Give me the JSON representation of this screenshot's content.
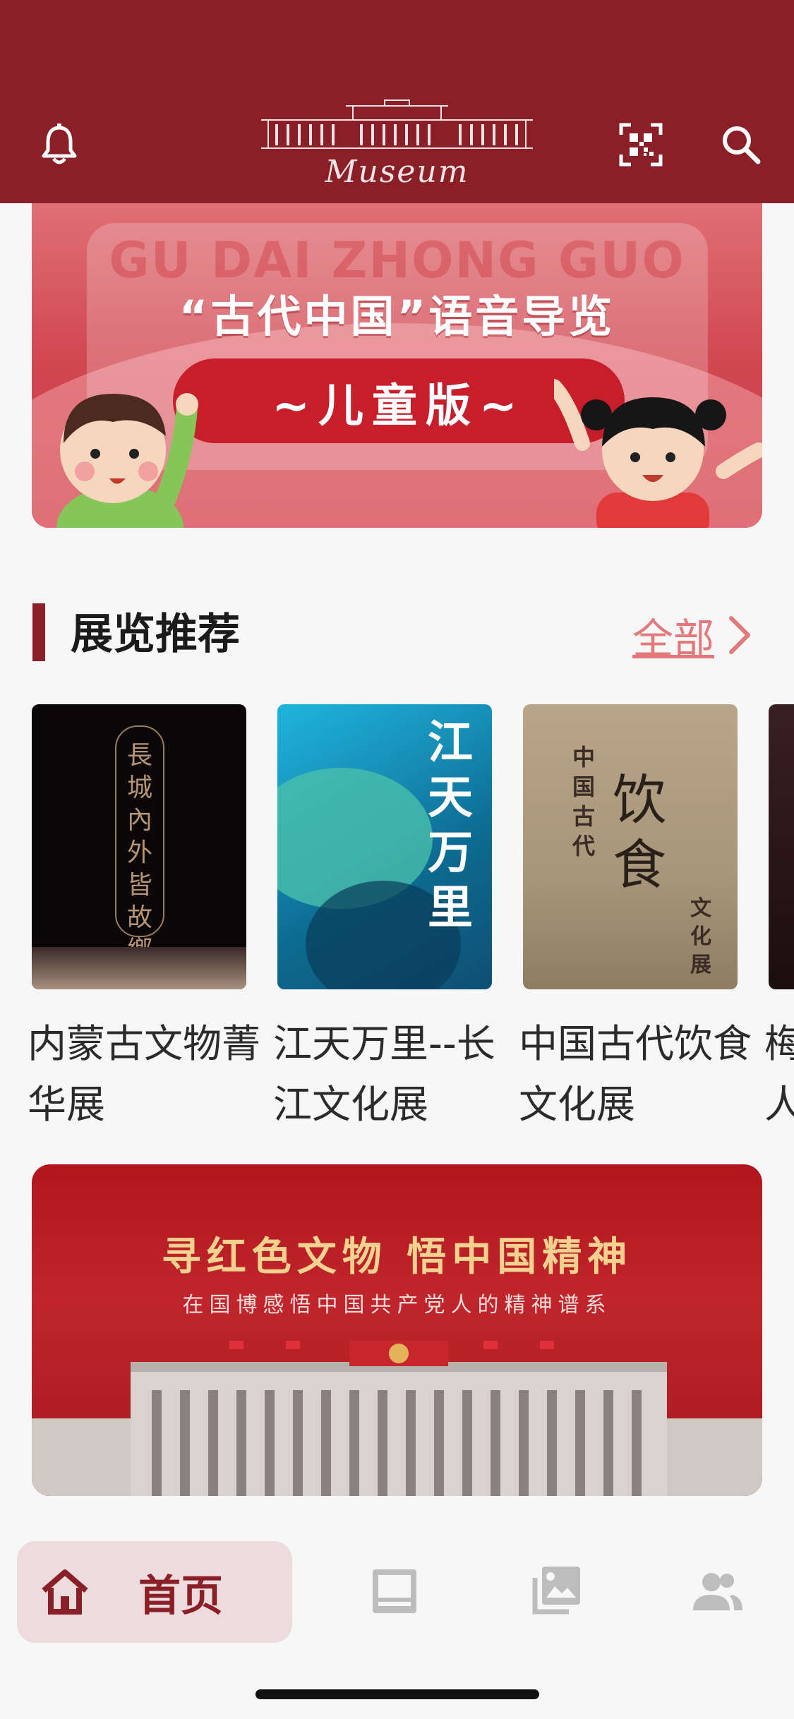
{
  "header": {
    "logo_text": "Museum",
    "icons": [
      "bell-icon",
      "qr-scan-icon",
      "search-icon"
    ],
    "bg_color": "#8a1f27"
  },
  "banner_top": {
    "ghost_text": "GU DAI ZHONG GUO",
    "title": "“古代中国”语音导览",
    "subtitle": "~儿童版~"
  },
  "section": {
    "title": "展览推荐",
    "see_all": "全部"
  },
  "exhibitions": [
    {
      "caption": "内蒙古文物菁华展",
      "cover_text": "長城內外皆故鄉"
    },
    {
      "caption": "江天万里--长江文化展",
      "cover_text": "江天万里"
    },
    {
      "caption": "中国古代饮食文化展",
      "cover_side": "中国古代",
      "cover_big": "饮食",
      "cover_small": "文化展"
    },
    {
      "caption": "梅人"
    }
  ],
  "banner_bottom": {
    "title": "寻红色文物  悟中国精神",
    "subtitle": "在国博感悟中国共产党人的精神谱系"
  },
  "nav": {
    "home_label": "首页",
    "items": [
      "home-icon",
      "exhibition-icon",
      "collection-icon",
      "profile-icon"
    ],
    "accent": "#8a1f27"
  }
}
